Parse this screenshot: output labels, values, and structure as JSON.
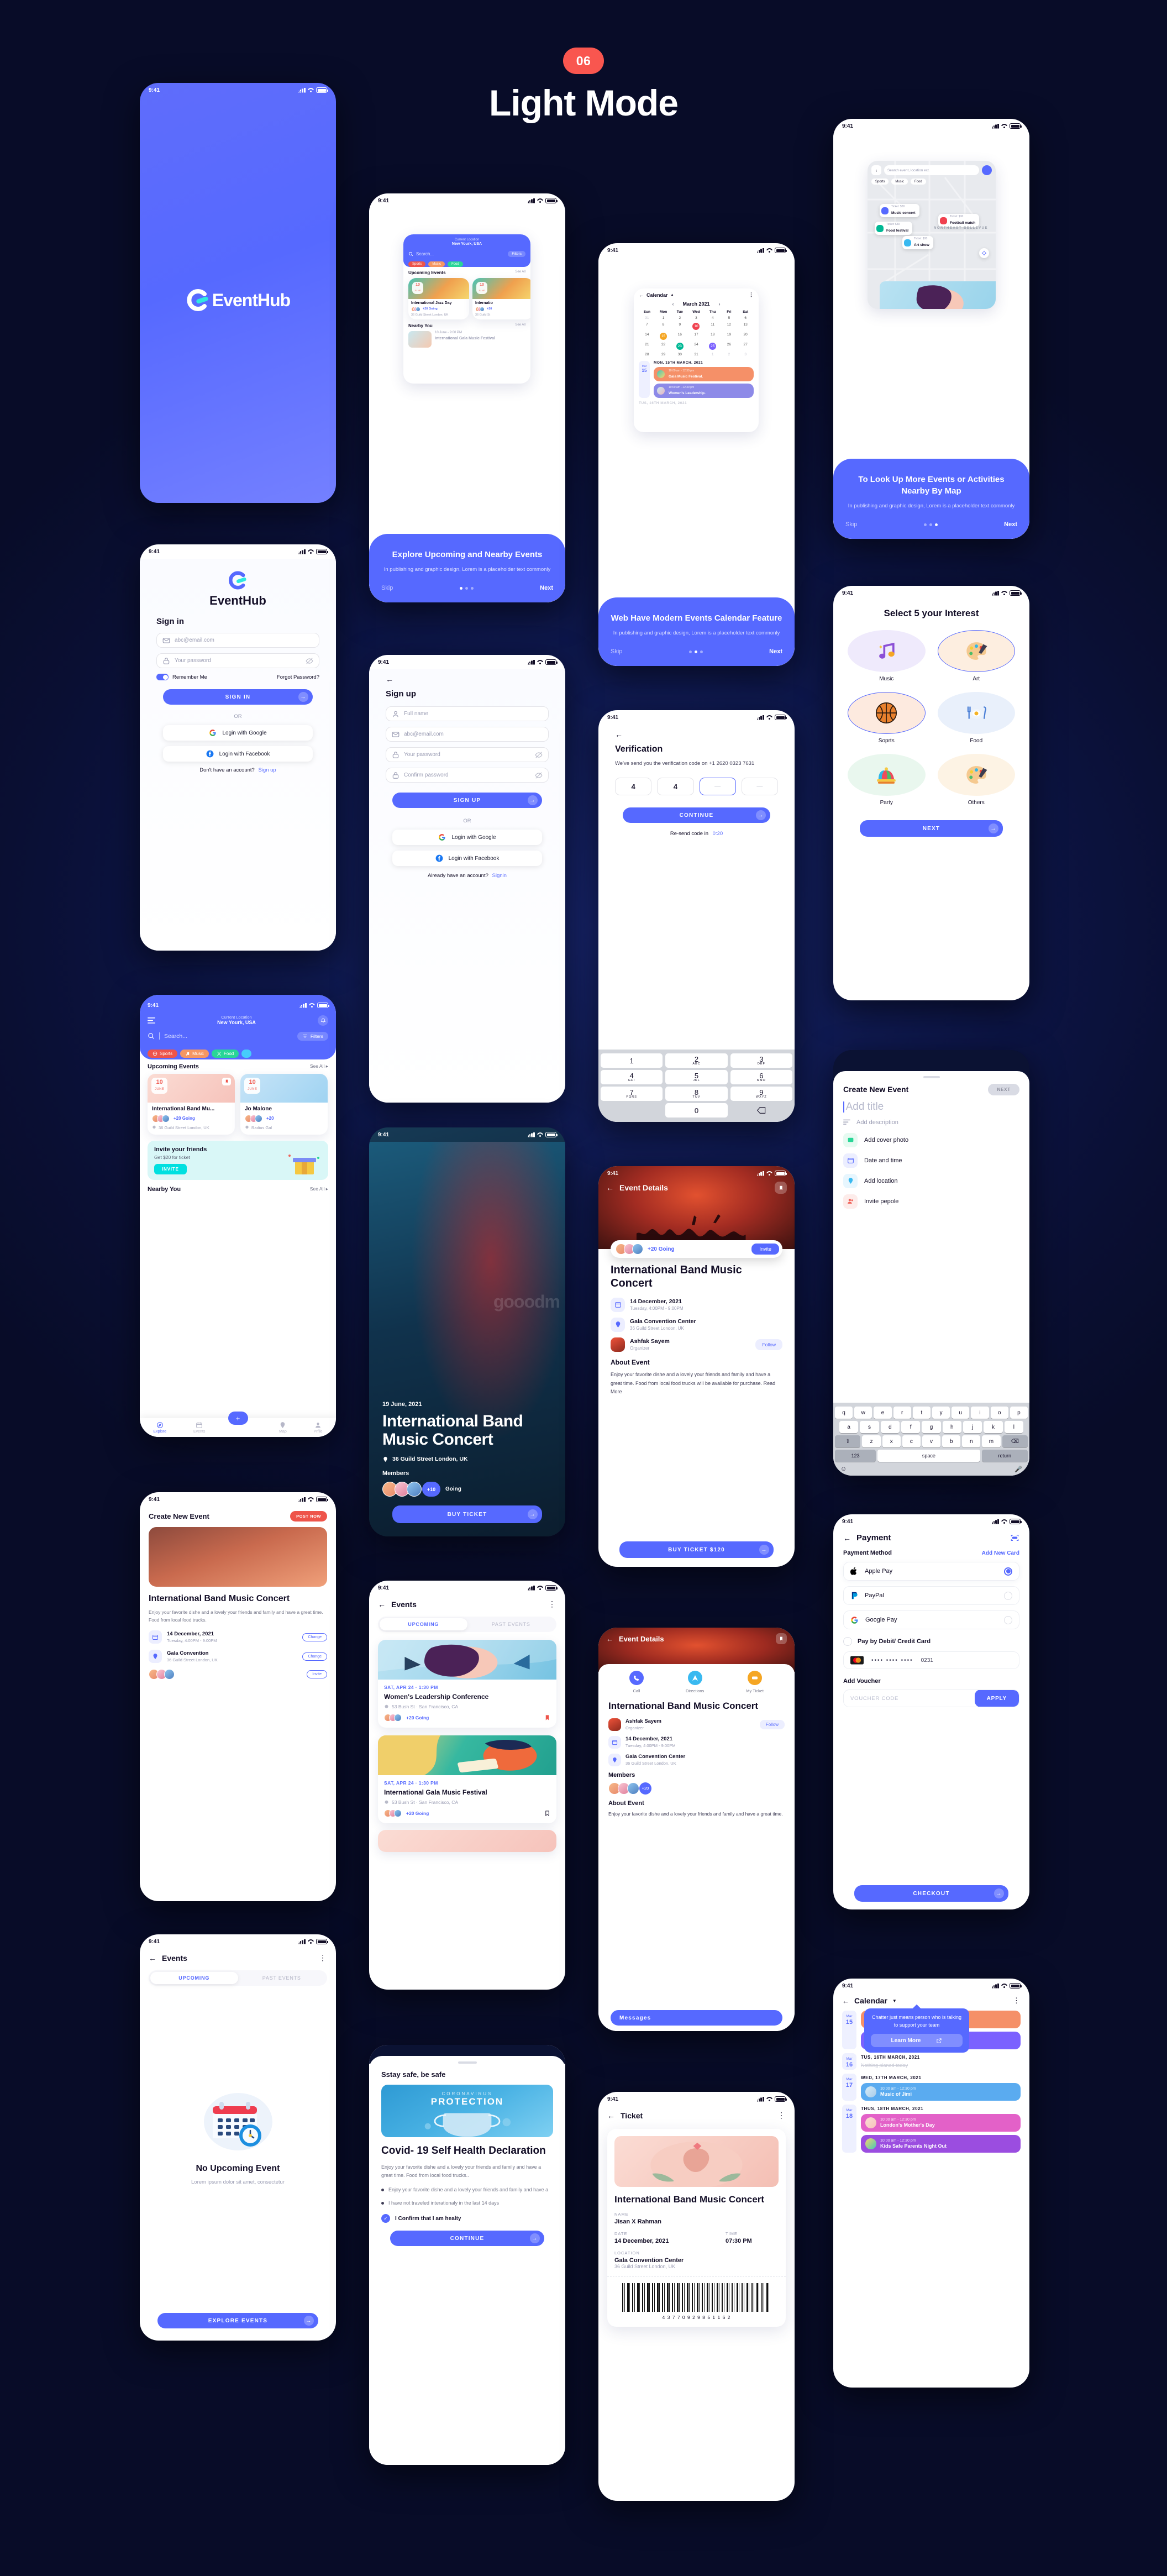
{
  "header": {
    "badge": "06",
    "title": "Light Mode"
  },
  "status_bar": {
    "time": "9:41"
  },
  "brand": {
    "name": "EventHub",
    "name_part1": "e",
    "name_part2": "vent",
    "name_part3": "Hub",
    "accent": "#5669ff",
    "cyan": "#2ee8e0"
  },
  "splash": {
    "logo_text": "EventHub"
  },
  "signin": {
    "logo_title": "EventHub",
    "heading": "Sign in",
    "email_placeholder": "abc@email.com",
    "password_placeholder": "Your password",
    "remember_label": "Remember Me",
    "forgot_label": "Forgot Password?",
    "submit_label": "SIGN IN",
    "or_label": "OR",
    "google_label": "Login with Google",
    "facebook_label": "Login with Facebook",
    "footer_text": "Don't have an account?",
    "footer_link": "Sign up"
  },
  "signup": {
    "heading": "Sign up",
    "name_placeholder": "Full name",
    "email_placeholder": "abc@email.com",
    "password_placeholder": "Your password",
    "confirm_placeholder": "Confirm password",
    "submit_label": "SIGN UP",
    "or_label": "OR",
    "google_label": "Login with Google",
    "facebook_label": "Login with Facebook",
    "footer_text": "Already have an account?",
    "footer_link": "Signin"
  },
  "verification": {
    "heading": "Verification",
    "subtitle": "We've send you the verification code on +1 2620 0323 7631",
    "digits": [
      "4",
      "4",
      "",
      ""
    ],
    "submit_label": "CONTINUE",
    "resend_label": "Re-send code in",
    "resend_timer": "0:20",
    "keypad": [
      {
        "num": "1",
        "sub": ""
      },
      {
        "num": "2",
        "sub": "ABC"
      },
      {
        "num": "3",
        "sub": "DEF"
      },
      {
        "num": "4",
        "sub": "GHI"
      },
      {
        "num": "5",
        "sub": "JKL"
      },
      {
        "num": "6",
        "sub": "MNO"
      },
      {
        "num": "7",
        "sub": "PQRS"
      },
      {
        "num": "8",
        "sub": "TUV"
      },
      {
        "num": "9",
        "sub": "WXYZ"
      },
      {
        "num": "0",
        "sub": ""
      }
    ]
  },
  "onboarding": [
    {
      "title": "Explore Upcoming and Nearby Events",
      "body": "In publishing and graphic design, Lorem is a placeholder text commonly",
      "skip": "Skip",
      "next": "Next",
      "active_dot": 0
    },
    {
      "title": "Web Have Modern Events Calendar Feature",
      "body": "In publishing and graphic design, Lorem is a placeholder text commonly",
      "skip": "Skip",
      "next": "Next",
      "active_dot": 1
    },
    {
      "title": "To Look Up More Events or Activities Nearby By Map",
      "body": "In publishing and graphic design, Lorem is a placeholder text commonly",
      "skip": "Skip",
      "next": "Next",
      "active_dot": 2
    }
  ],
  "ob_home_preview": {
    "location_label": "Current Location",
    "location_value": "New Yourk, USA",
    "search_placeholder": "Search...",
    "filters_label": "Filters",
    "chips": [
      "Sports",
      "Music",
      "Food"
    ],
    "section1": "Upcoming Events",
    "see_all": "See All",
    "card1_title": "International Jazz Day",
    "card1_going": "+20 Going",
    "card1_place": "36 Guild Street London, UK",
    "card2_title": "Internatio",
    "card2_going": "+20",
    "card2_place": "36 Guild St",
    "card_day": "10",
    "card_month": "JUNE",
    "section2": "Nearby You",
    "nearby_time": "10 June - 9:00 PM",
    "nearby_title": "International Gala Music Festival"
  },
  "ob_calendar_preview": {
    "title": "Calendar",
    "month": "March 2021",
    "weekdays": [
      "Sun",
      "Mon",
      "Tue",
      "Wed",
      "Thu",
      "Fri",
      "Sat"
    ],
    "weeks": [
      [
        "31",
        "1",
        "2",
        "3",
        "4",
        "5",
        "6"
      ],
      [
        "7",
        "8",
        "9",
        "10",
        "11",
        "12",
        "13"
      ],
      [
        "14",
        "15",
        "16",
        "17",
        "18",
        "19",
        "20"
      ],
      [
        "21",
        "22",
        "23",
        "24",
        "25",
        "26",
        "27"
      ],
      [
        "28",
        "29",
        "30",
        "31",
        "1",
        "2",
        "3"
      ]
    ],
    "marked": {
      "10": "#f0414f",
      "15": "#f5a623",
      "23": "#00b894",
      "25": "#7b61ff"
    },
    "day_chip_month": "Mar",
    "day_chip_day": "15",
    "day_header": "MON, 15TH MARCH, 2021",
    "events": [
      {
        "time": "10:00 am - 12:30 pm",
        "name": "Gala Music Festival.",
        "color": "#f59068"
      },
      {
        "time": "10:00 am - 12:30 pm",
        "name": "Women's Leadership.",
        "color": "#8d8ae8"
      }
    ],
    "next_header": "TUS, 16TH MARCH, 2021"
  },
  "ob_map_preview": {
    "search_placeholder": "Search event, location ect.",
    "chips": [
      "Sports",
      "Music",
      "Food"
    ],
    "pins": [
      {
        "ticket": "Ticket: $30",
        "name": "Music concert",
        "color": "#5669ff"
      },
      {
        "ticket": "Ticket: $30",
        "name": "Football match",
        "color": "#f0414f"
      },
      {
        "ticket": "Ticket: $30",
        "name": "Food festival",
        "color": "#00b894"
      },
      {
        "ticket": "Ticket: $30",
        "name": "Art show",
        "color": "#39b9f0"
      }
    ],
    "area_label": "NORTHEAST BELLEVUE"
  },
  "interests": {
    "heading": "Select 5 your Interest",
    "items": [
      {
        "label": "Music",
        "icon": "music-note-icon",
        "selected": false,
        "bg": "#efeafc"
      },
      {
        "label": "Art",
        "icon": "paint-palette-icon",
        "selected": true,
        "bg": "#fdeee0"
      },
      {
        "label": "Soprts",
        "icon": "basketball-icon",
        "selected": true,
        "bg": "#fdeadf"
      },
      {
        "label": "Food",
        "icon": "plate-fork-icon",
        "selected": false,
        "bg": "#e9f0fb"
      },
      {
        "label": "Party",
        "icon": "jester-hat-icon",
        "selected": false,
        "bg": "#e9f7ee"
      },
      {
        "label": "Others",
        "icon": "paint-palette-icon",
        "selected": false,
        "bg": "#fdf3e4"
      }
    ],
    "next_label": "NEXT"
  },
  "home": {
    "location_label": "Current Location",
    "location_value": "New Yourk, USA",
    "search_placeholder": "Search...",
    "filters_label": "Filters",
    "chips": [
      {
        "label": "Sports",
        "color": "#ee544a",
        "icon": "basketball-icon"
      },
      {
        "label": "Music",
        "color": "#f59762",
        "icon": "music-note-icon"
      },
      {
        "label": "Food",
        "color": "#29d697",
        "icon": "fork-knife-icon"
      }
    ],
    "section_upcoming": "Upcoming Events",
    "section_nearby": "Nearby You",
    "see_all": "See All",
    "cards": [
      {
        "day": "10",
        "month": "JUNE",
        "title": "International Band Mu...",
        "going": "+20 Going",
        "place": "36 Guild Street London, UK"
      },
      {
        "day": "10",
        "month": "JUNE",
        "title": "Jo Malone",
        "going": "+20",
        "place": "Radius Gal"
      }
    ],
    "invite": {
      "title": "Invite your friends",
      "subtitle": "Get $20 for ticket",
      "button": "INVITE"
    },
    "nav": [
      {
        "label": "Explore",
        "icon": "compass-icon",
        "active": true
      },
      {
        "label": "Events",
        "icon": "calendar-icon",
        "active": false
      },
      {
        "label": "Map",
        "icon": "map-pin-icon",
        "active": false
      },
      {
        "label": "Prfile",
        "icon": "person-icon",
        "active": false
      }
    ],
    "fab_icon": "plus-icon"
  },
  "concert_hero": {
    "date": "19 June, 2021",
    "title": "International Band Music Concert",
    "location": "36 Guild Street London, UK",
    "members_label": "Members",
    "plus_count": "+10",
    "going_label": "Going",
    "buy_label": "BUY TICKET",
    "watermark": "gooodm"
  },
  "event_details": {
    "header": "Event Details",
    "going": "+20 Going",
    "invite_label": "Invite",
    "title": "International Band Music Concert",
    "date_main": "14 December, 2021",
    "date_sub": "Tuesday, 4:00PM - 9:00PM",
    "venue_main": "Gala Convention Center",
    "venue_sub": "36 Guild Street London, UK",
    "organizer_name": "Ashfak Sayem",
    "organizer_role": "Organizer",
    "follow_label": "Follow",
    "about_heading": "About Event",
    "about_body": "Enjoy your favorite dishe and a lovely your friends and family and have a great time. Food from local food trucks will be available for purchase. Read More",
    "buy_label": "BUY TICKET $120"
  },
  "event_details_2": {
    "header": "Event Details",
    "actions": [
      {
        "label": "Call",
        "icon": "phone-icon",
        "color": "#5669ff"
      },
      {
        "label": "Directions",
        "icon": "compass-icon",
        "color": "#39b9f0"
      },
      {
        "label": "My Ticket",
        "icon": "ticket-icon",
        "color": "#f5a623"
      }
    ],
    "title": "International Band Music Concert",
    "organizer_name": "Ashfak Sayem",
    "organizer_role": "Organizer",
    "follow_label": "Follow",
    "date_main": "14 December, 2021",
    "date_sub": "Tuesday, 4:00PM - 9:00PM",
    "venue_main": "Gala Convention Center",
    "venue_sub": "36 Guild Street London, UK",
    "members_heading": "Members",
    "plus_count": "+20",
    "about_heading": "About Event",
    "about_body": "Enjoy your favorite dishe and a lovely your friends and family and have a great time.",
    "messages_label": "Messages"
  },
  "create_event_post": {
    "header": "Create New Event",
    "post_label": "POST NOW",
    "title": "International Band Music Concert",
    "body": "Enjoy your favorite dishe and a lovely your friends and family and have a great time. Food from local food trucks.",
    "rows": [
      {
        "main": "14 December, 2021",
        "sub": "Tuesday, 4:00PM - 9:00PM",
        "action": "Change",
        "icon": "calendar-icon"
      },
      {
        "main": "Gala Convention",
        "sub": "36 Guild Street London, UK",
        "action": "Change",
        "icon": "map-pin-icon"
      }
    ],
    "invite_action": "Invite"
  },
  "create_event": {
    "header": "Create New Event",
    "next_label": "NEXT",
    "title_placeholder": "Add title",
    "description_placeholder": "Add description",
    "rows": [
      {
        "label": "Add cover photo",
        "icon": "image-icon",
        "color": "#29d697",
        "bg": "#e6faf1"
      },
      {
        "label": "Date and time",
        "icon": "calendar-icon",
        "color": "#5669ff",
        "bg": "#eceeff"
      },
      {
        "label": "Add location",
        "icon": "map-pin-icon",
        "color": "#39b9f0",
        "bg": "#e7f6fe"
      },
      {
        "label": "Invite pepole",
        "icon": "people-icon",
        "color": "#f0635a",
        "bg": "#fdecea"
      }
    ],
    "keyboard": {
      "row1": [
        "q",
        "w",
        "e",
        "r",
        "t",
        "y",
        "u",
        "i",
        "o",
        "p"
      ],
      "row2": [
        "a",
        "s",
        "d",
        "f",
        "g",
        "h",
        "j",
        "k",
        "l"
      ],
      "row3": [
        "z",
        "x",
        "c",
        "v",
        "b",
        "n",
        "m"
      ],
      "num_key": "123",
      "space_key": "space",
      "return_key": "return",
      "shift_icon": "shift-icon",
      "delete_icon": "backspace-icon",
      "emoji_icon": "emoji-icon",
      "mic_icon": "microphone-icon"
    }
  },
  "events_list": {
    "header": "Events",
    "tabs": [
      {
        "label": "UPCOMING",
        "active": true
      },
      {
        "label": "PAST EVENTS",
        "active": false
      }
    ],
    "items": [
      {
        "datetime": "SAT, APR 24 · 1:30 PM",
        "title": "Women's Leadership Conference",
        "place": "53 Bush St · San Francisco, CA",
        "going": "+20 Going",
        "bookmarked": true
      },
      {
        "datetime": "SAT, APR 24 · 1:30 PM",
        "title": "International Gala Music Festival",
        "place": "53 Bush St · San Francisco, CA",
        "going": "+20 Going",
        "bookmarked": false
      }
    ]
  },
  "events_empty": {
    "header": "Events",
    "tabs": [
      {
        "label": "UPCOMING",
        "active": true
      },
      {
        "label": "PAST EVENTS",
        "active": false
      }
    ],
    "title": "No Upcoming Event",
    "subtitle": "Lorem ipsum dolor sit amet, consectetur",
    "button": "EXPLORE EVENTS"
  },
  "covid": {
    "eyebrow": "Sstay safe, be safe",
    "banner_small": "CORONAVIRUS",
    "banner_big": "PROTECTION",
    "title": "Covid- 19 Self Health Declaration",
    "body": "Enjoy your favorite dishe and a lovely your friends and family and have a great time. Food from local food trucks..",
    "bullets": [
      "Enjoy your favorite dishe and a lovely your friends and family and have a",
      "I have not traveled interationaly in the last 14 days"
    ],
    "confirm_label": "I Confirm that I am healty",
    "button": "CONTINUE"
  },
  "payment": {
    "header": "Payment",
    "method_label": "Payment Method",
    "add_card_label": "Add New Card",
    "methods": [
      {
        "label": "Apple Pay",
        "icon": "apple-icon",
        "selected": true
      },
      {
        "label": "PayPal",
        "icon": "paypal-icon",
        "selected": false
      },
      {
        "label": "Google Pay",
        "icon": "google-icon",
        "selected": false
      }
    ],
    "debit_label": "Pay by Debit/ Credit Card",
    "card_mask": "••••  ••••  ••••",
    "card_last4": "0231",
    "voucher_heading": "Add Voucher",
    "voucher_placeholder": "VOUCHER CODE",
    "apply_label": "APPLY",
    "checkout_label": "CHECKOUT"
  },
  "ticket": {
    "header": "Ticket",
    "title": "International Band Music Concert",
    "name_label": "NAME",
    "name_value": "Jisan X Rahman",
    "date_label": "DATE",
    "date_value": "14 December, 2021",
    "time_label": "TIME",
    "time_value": "07:30 PM",
    "location_label": "LOCATION",
    "location_value": "Gala Convention Center",
    "location_sub": "36 Guild Street London, UK",
    "barcode_number": "4 3 7 7 0 9 2 9 8 5 1 1 6 2"
  },
  "calendar": {
    "header": "Calendar",
    "tooltip_text": "Chatter just means  person who is talking to support your team",
    "tooltip_button": "Learn More",
    "days": [
      {
        "chip_month": "Mar",
        "chip_day": "15",
        "header": "",
        "events": [
          {
            "time": "10:00 am - 12:30 pm",
            "name": "Gala Music Festival.",
            "color": "#f59068"
          },
          {
            "time": "10:00 am - 12:30 pm",
            "name": "Women's Leadership.",
            "color": "#7b61ff"
          }
        ]
      },
      {
        "chip_month": "Mar",
        "chip_day": "16",
        "header": "TUS, 16TH MARCH, 2021",
        "empty": "Nothing planed today",
        "events": []
      },
      {
        "chip_month": "Mar",
        "chip_day": "17",
        "header": "WED, 17TH MARCH, 2021",
        "events": [
          {
            "time": "10:00 am - 12:30 pm",
            "name": "Music of Jimi",
            "color": "#5aabf0"
          }
        ]
      },
      {
        "chip_month": "Mar",
        "chip_day": "18",
        "header": "THUS, 18TH MARCH, 2021",
        "events": [
          {
            "time": "10:00 am - 12:30 pm",
            "name": "London's Mother's Day",
            "color": "#e361c8"
          },
          {
            "time": "10:00 am - 12:30 pm",
            "name": "Kids Safe Parents Night Out",
            "color": "#9b4de0"
          }
        ]
      }
    ]
  }
}
